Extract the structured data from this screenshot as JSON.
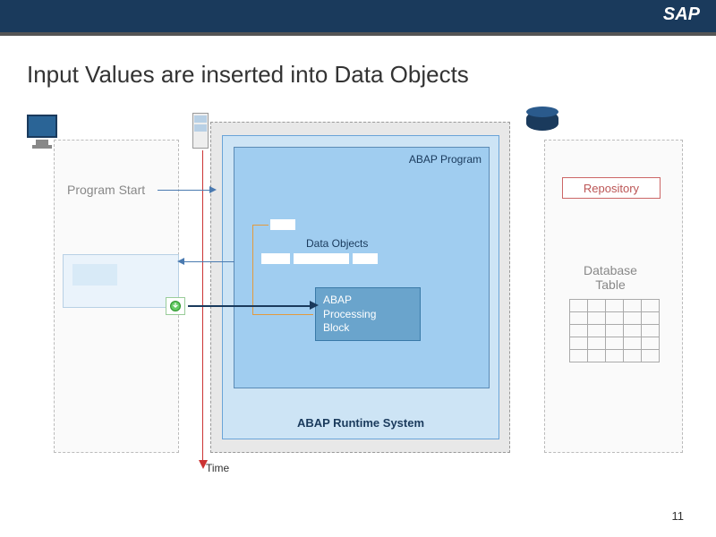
{
  "header": {
    "brand": "SAP"
  },
  "title": "Input Values are inserted into Data Objects",
  "left": {
    "program_start": "Program Start"
  },
  "runtime": {
    "program_label": "ABAP Program",
    "data_objects_label": "Data Objects",
    "processing_block": "ABAP\nProcessing\nBlock",
    "system_label": "ABAP Runtime System"
  },
  "right": {
    "repository": "Repository",
    "db_table": "Database\nTable"
  },
  "time_label": "Time",
  "page_number": "11"
}
